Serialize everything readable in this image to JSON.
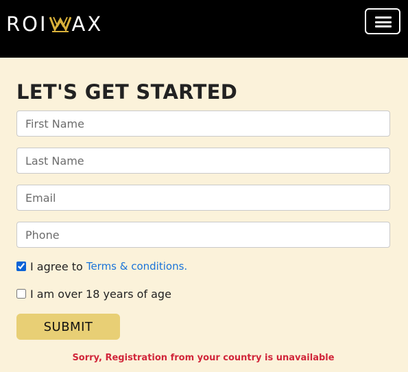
{
  "header": {
    "logo": {
      "text_left": "ROI",
      "text_right": "AX",
      "mark_icon": "crown-m-icon",
      "mark_color": "#d9b13b"
    },
    "menu_icon": "hamburger-menu-icon"
  },
  "form": {
    "title": "LET'S GET STARTED",
    "fields": {
      "first_name": {
        "placeholder": "First Name",
        "value": ""
      },
      "last_name": {
        "placeholder": "Last Name",
        "value": ""
      },
      "email": {
        "placeholder": "Email",
        "value": ""
      },
      "phone": {
        "placeholder": "Phone",
        "value": ""
      }
    },
    "terms": {
      "checked": true,
      "label": "I agree to",
      "link_text": "Terms & conditions."
    },
    "age": {
      "checked": false,
      "label": "I am over 18 years of age"
    },
    "submit_label": "SUBMIT",
    "error_message": "Sorry, Registration from your country is unavailable"
  },
  "colors": {
    "page_background": "#fbf2da",
    "header_background": "#000000",
    "submit_background": "#e8cf75",
    "link": "#1a73d9",
    "error": "#d1263a"
  }
}
